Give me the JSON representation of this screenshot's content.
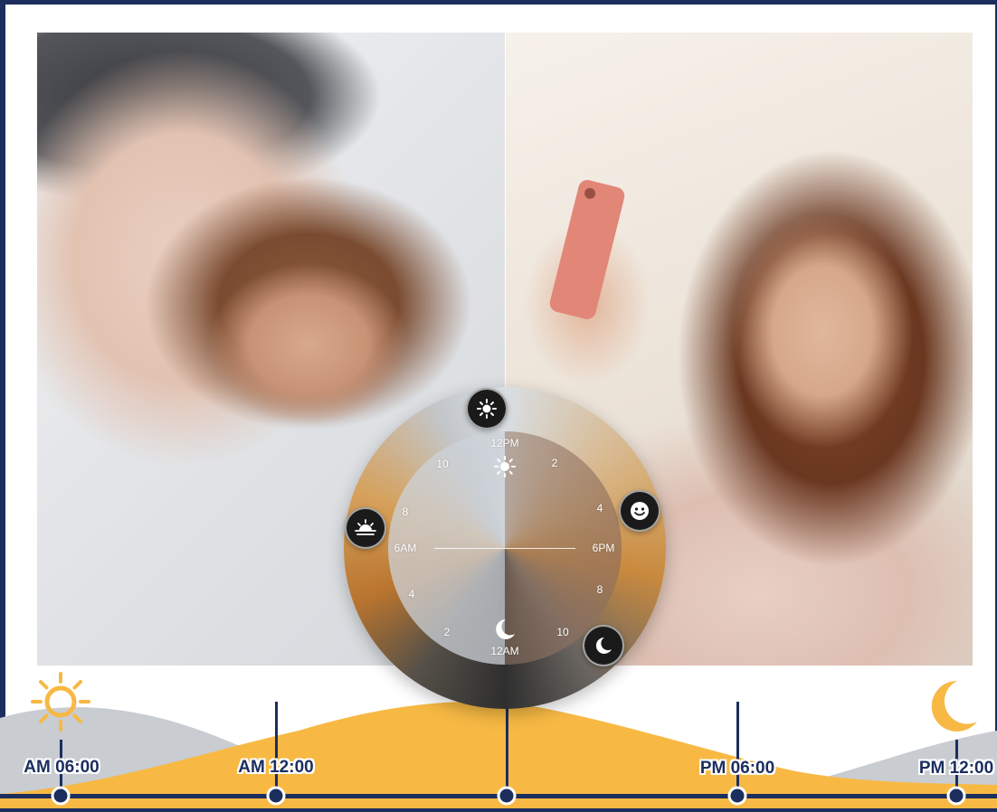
{
  "colors": {
    "navy": "#1b2e5e",
    "gold": "#f7b944",
    "grey_wave": "#c9ccd1",
    "badge_dark": "#1a1a1a"
  },
  "photos": {
    "left": {
      "icon": "morning-stretch-photo"
    },
    "right": {
      "icon": "night-phone-photo"
    }
  },
  "clock": {
    "ticks": {
      "t12pm": "12PM",
      "t2": "2",
      "t4": "4",
      "t6pm": "6PM",
      "t8": "8",
      "t10": "10",
      "t12am": "12AM",
      "t2b": "2",
      "t4b": "4",
      "t6am": "6AM",
      "t8b": "8",
      "t10b": "10"
    },
    "icons": {
      "top": "sun-icon",
      "right": "smiley-icon",
      "bottom_right": "moon-icon",
      "left": "sunrise-icon",
      "center_top": "sun-icon",
      "center_bottom": "moon-icon"
    }
  },
  "timeline": {
    "labels": {
      "l1": "AM 06:00",
      "l2": "AM 12:00",
      "l3": "PM 06:00",
      "l4": "PM 12:00"
    },
    "icons": {
      "start": "sun-icon",
      "end": "crescent-moon-icon"
    }
  }
}
